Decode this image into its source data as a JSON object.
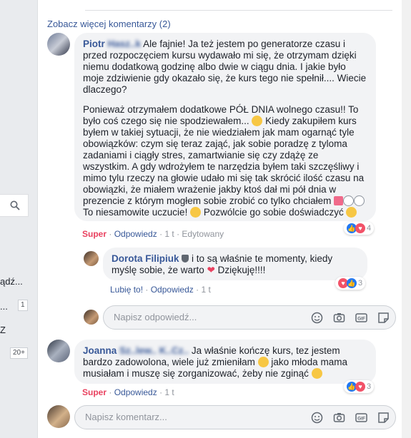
{
  "sidebar": {
    "text_a": "ądź...",
    "text_b": "...",
    "badge_b": "1",
    "text_c": "Z",
    "badge_c": "20+"
  },
  "see_more": "Zobacz więcej komentarzy (2)",
  "comment1": {
    "author_first": "Piotr",
    "author_last": "Hasz..k",
    "para1": "Ale fajnie! Ja też jestem po generatorze czasu i przed rozpoczęciem kursu wydawało mi się, że otrzymam dzięki niemu dodatkową godzinę albo dwie w ciągu dnia. I jakie było moje zdziwienie gdy okazało się, że kurs tego nie spełnił.... Wiecie dlaczego?",
    "para2_a": "Ponieważ otrzymałem dodatkowe PÓŁ DNIA wolnego czasu!! To było coś czego się nie spodziewałem...",
    "para2_b": "Kiedy zakupiłem kurs byłem w takiej sytuacji, że nie wiedziałem jak mam ogarnąć tyle obowiązków: czym się teraz zająć, jak sobie poradzę z tyloma zadaniami i ciągły stres, zamartwianie się czy zdążę ze wszystkim. A gdy wdrożyłem te narzędzia byłem taki szczęśliwy i mimo tylu rzeczy na głowie udało mi się tak skrócić ilość czasu na obowiązki, że miałem wrażenie jakby ktoś dał mi pół dnia w prezencie z którym mogłem sobie zrobić co tylko chciałem",
    "para2_c": "To niesamowite uczucie!",
    "para2_d": "Pozwólcie go sobie doświadczyć",
    "act_super": "Super",
    "act_reply": "Odpowiedz",
    "act_time": "1 t",
    "act_edited": "Edytowany",
    "reactions_count": "4"
  },
  "reply1": {
    "author": "Dorota Filipiuk",
    "text_a": "i to są właśnie te momenty, kiedy myślę sobie, że warto",
    "text_b": "Dziękuję!!!!",
    "act_like": "Lubię to!",
    "act_reply": "Odpowiedz",
    "act_time": "1 t",
    "reactions_count": "3"
  },
  "reply_input_placeholder": "Napisz odpowiedź...",
  "comment2": {
    "author_first": "Joanna",
    "author_last": "Sz..lew.. K..Cz..",
    "text_a": "Ja właśnie kończę kurs, tez jestem bardzo zadowolona, wiele już zmieniłam",
    "text_b": "jako młoda mama musiałam i muszę się zorganizować, żeby nie zginąć",
    "act_super": "Super",
    "act_reply": "Odpowiedz",
    "act_time": "1 t",
    "reactions_count": "3"
  },
  "comment_input_placeholder": "Napisz komentarz..."
}
